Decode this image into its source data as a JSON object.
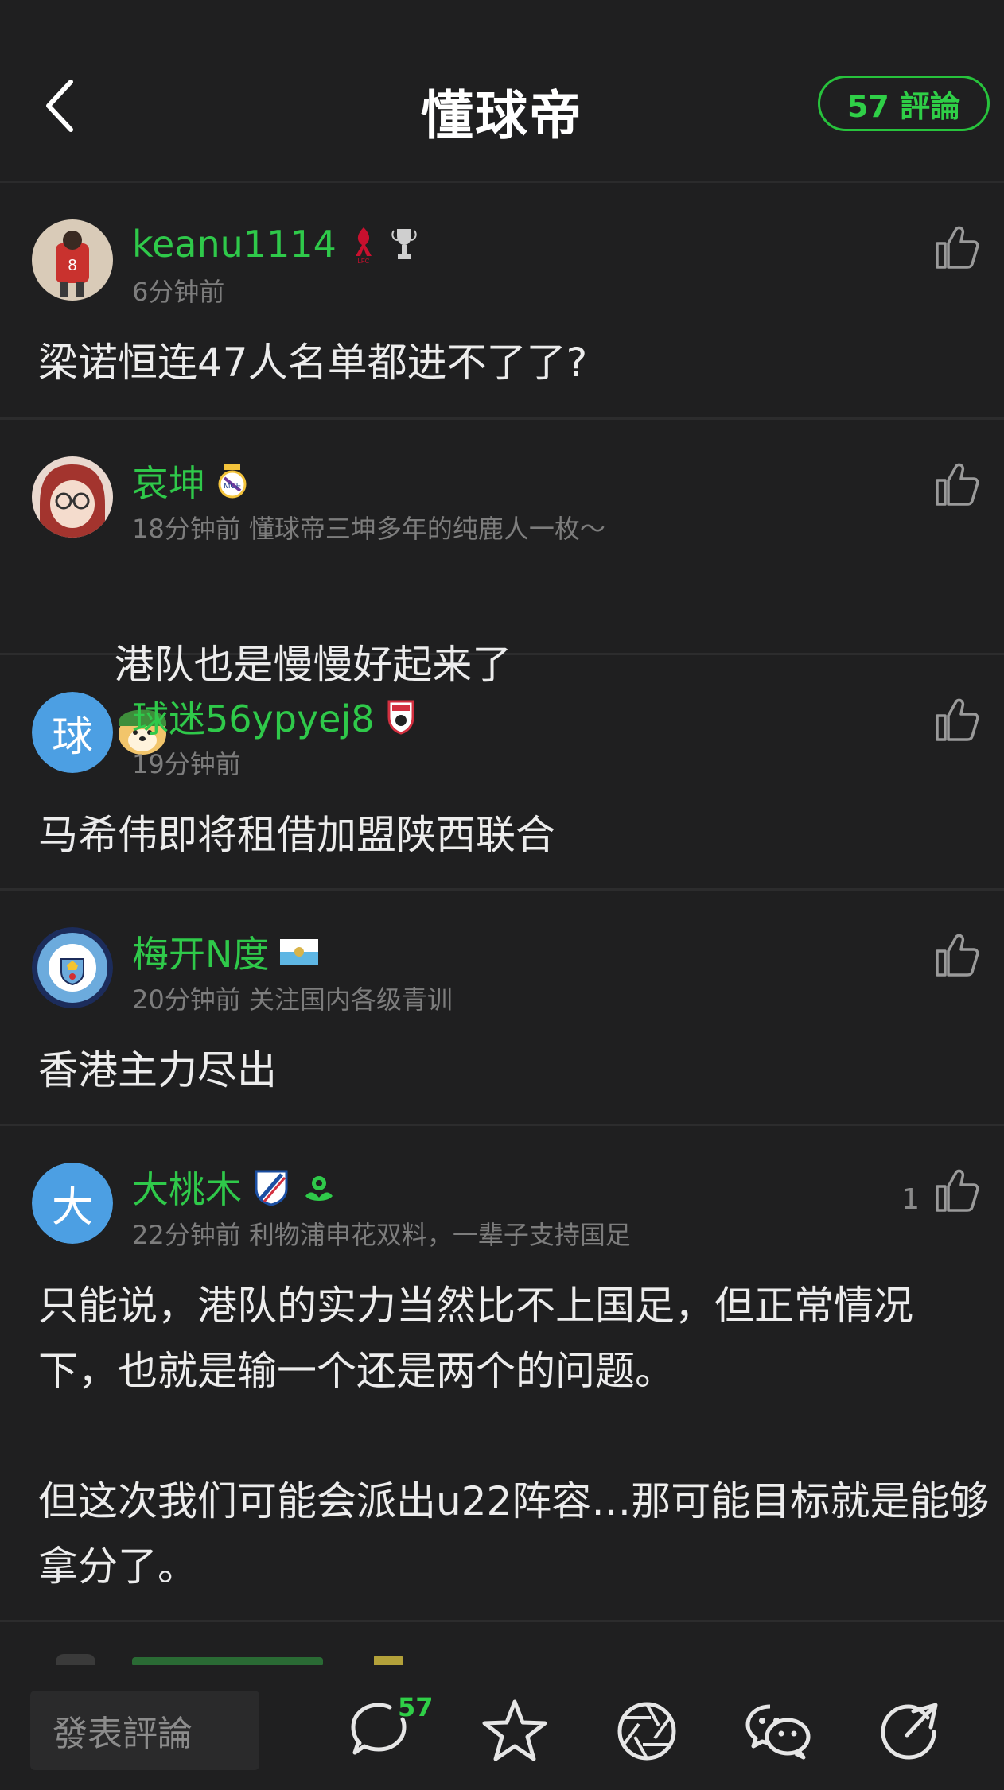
{
  "header": {
    "title": "懂球帝",
    "comments_count_label": "57 評論"
  },
  "comments": [
    {
      "username": "keanu1114",
      "time": "6分钟前",
      "bio": "",
      "text": "梁诺恒连47人名单都进不了了?",
      "likes": "",
      "badges": [
        "liverpool-badge",
        "trophy-badge"
      ]
    },
    {
      "username": "哀坤",
      "time": "18分钟前",
      "bio": "懂球帝三坤多年的纯鹿人一枚～",
      "text": "港队也是慢慢好起来了",
      "likes": "",
      "badges": [
        "real-madrid-badge"
      ]
    },
    {
      "username": "球迷56ypyej8",
      "time": "19分钟前",
      "bio": "",
      "text": "马希伟即将租借加盟陕西联合",
      "likes": "",
      "avatar_letter": "球",
      "badges": [
        "club-badge"
      ]
    },
    {
      "username": "梅开N度",
      "time": "20分钟前",
      "bio": "关注国内各级青训",
      "text": "香港主力尽出",
      "likes": "",
      "badges": [
        "san-marino-flag"
      ]
    },
    {
      "username": "大桃木",
      "time": "22分钟前",
      "bio": "利物浦申花双料，一辈子支持国足",
      "text": "只能说，港队的实力当然比不上国足，但正常情况下，也就是输一个还是两个的问题。\n\n但这次我们可能会派出u22阵容…那可能目标就是能够拿分了。",
      "likes": "1",
      "avatar_letter": "大",
      "badges": [
        "shenhua-badge",
        "fan-badge"
      ]
    }
  ],
  "bottom_bar": {
    "input_placeholder": "發表評論",
    "comment_count": "57",
    "icons": [
      "comment-icon",
      "star-icon",
      "aperture-icon",
      "wechat-icon",
      "share-icon"
    ]
  },
  "colors": {
    "background": "#1f1f20",
    "accent_green": "#2fc94a",
    "meta_gray": "#7d7d7d"
  }
}
